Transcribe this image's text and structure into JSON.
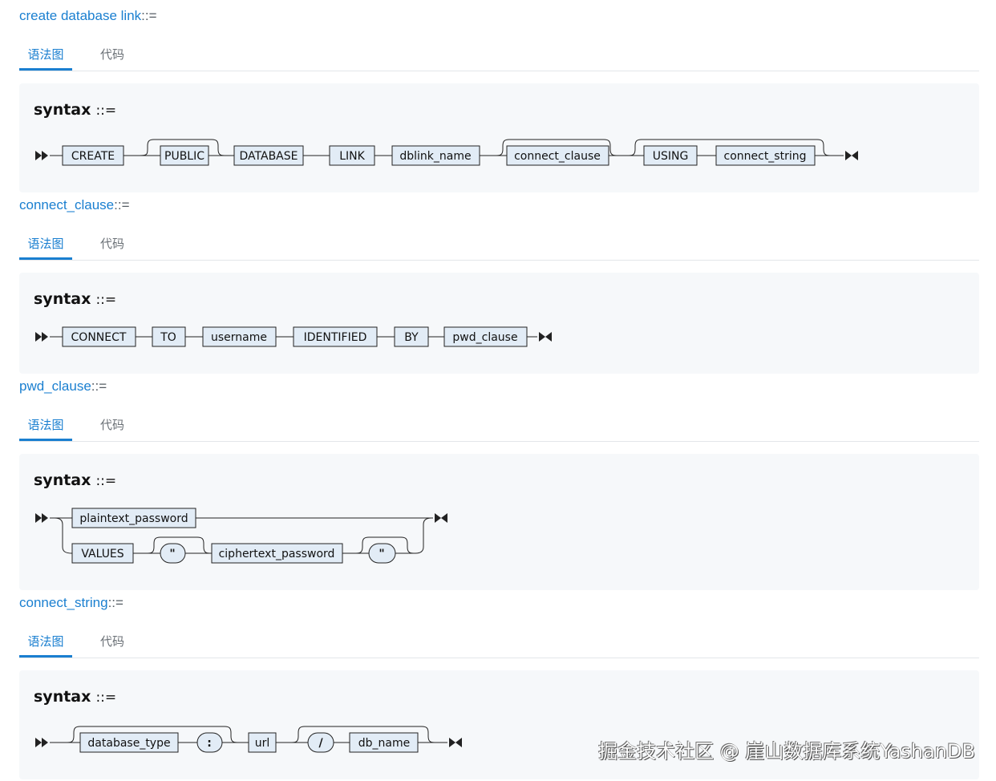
{
  "tabs": {
    "diagram": "语法图",
    "code": "代码"
  },
  "syntax_label": "syntax",
  "syntax_op": "::=",
  "sections": [
    {
      "name": "create database link",
      "suffix": "::=",
      "nodes": [
        "CREATE",
        "PUBLIC",
        "DATABASE",
        "LINK",
        "dblink_name",
        "connect_clause",
        "USING",
        "connect_string"
      ]
    },
    {
      "name": "connect_clause",
      "suffix": "::=",
      "nodes": [
        "CONNECT",
        "TO",
        "username",
        "IDENTIFIED",
        "BY",
        "pwd_clause"
      ]
    },
    {
      "name": "pwd_clause",
      "suffix": "::=",
      "nodes": [
        "plaintext_password",
        "VALUES",
        "\"",
        "ciphertext_password",
        "\""
      ]
    },
    {
      "name": "connect_string",
      "suffix": "::=",
      "nodes": [
        "database_type",
        ":",
        "url",
        "/",
        "db_name"
      ]
    }
  ],
  "watermark": "掘金技术社区 @ 崖山数据库系统YashanDB"
}
